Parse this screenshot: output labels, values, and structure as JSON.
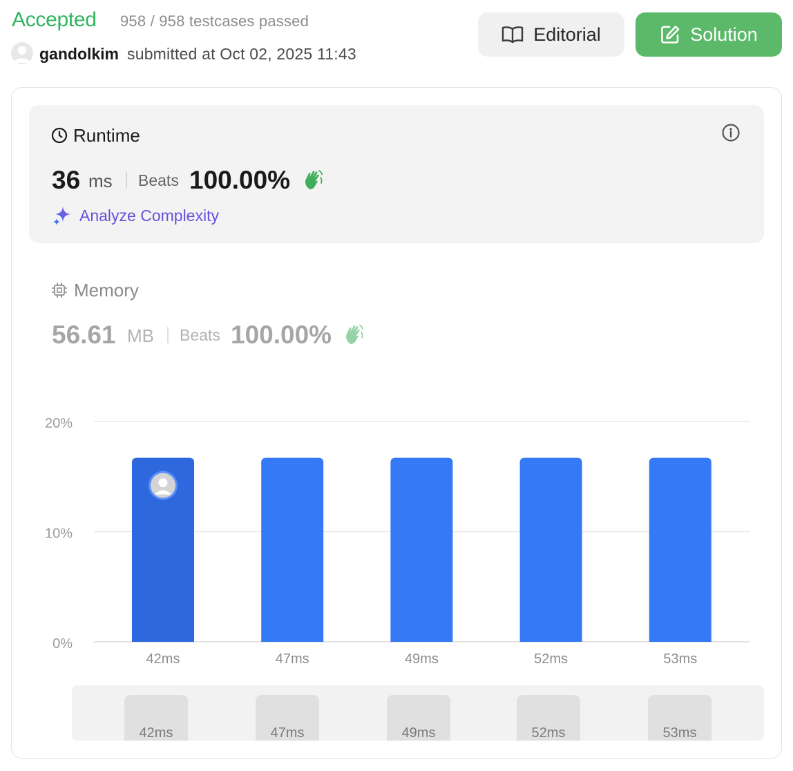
{
  "header": {
    "status": "Accepted",
    "testcases": "958 / 958 testcases passed",
    "username": "gandolkim",
    "submitted": "submitted at Oct 02, 2025 11:43",
    "editorial_label": "Editorial",
    "solution_label": "Solution",
    "status_color": "#2db55d",
    "solution_color": "#5cb96a"
  },
  "runtime": {
    "title": "Runtime",
    "value": "36",
    "unit": "ms",
    "beats_label": "Beats",
    "beats": "100.00%",
    "analyze_label": "Analyze Complexity"
  },
  "memory": {
    "title": "Memory",
    "value": "56.61",
    "unit": "MB",
    "beats_label": "Beats",
    "beats": "100.00%"
  },
  "scrubber": {
    "labels": [
      "42ms",
      "47ms",
      "49ms",
      "52ms",
      "53ms"
    ]
  },
  "chart_data": {
    "type": "bar",
    "categories": [
      "42ms",
      "47ms",
      "49ms",
      "52ms",
      "53ms"
    ],
    "values": [
      16.7,
      16.7,
      16.7,
      16.7,
      16.7
    ],
    "ylim": [
      0,
      20
    ],
    "yticks": [
      "0%",
      "10%",
      "20%"
    ],
    "ytick_values": [
      0,
      10,
      20
    ],
    "highlighted_index": 0,
    "bar_color": "#3579f6",
    "highlight_color": "#2d68de",
    "grid": true
  }
}
